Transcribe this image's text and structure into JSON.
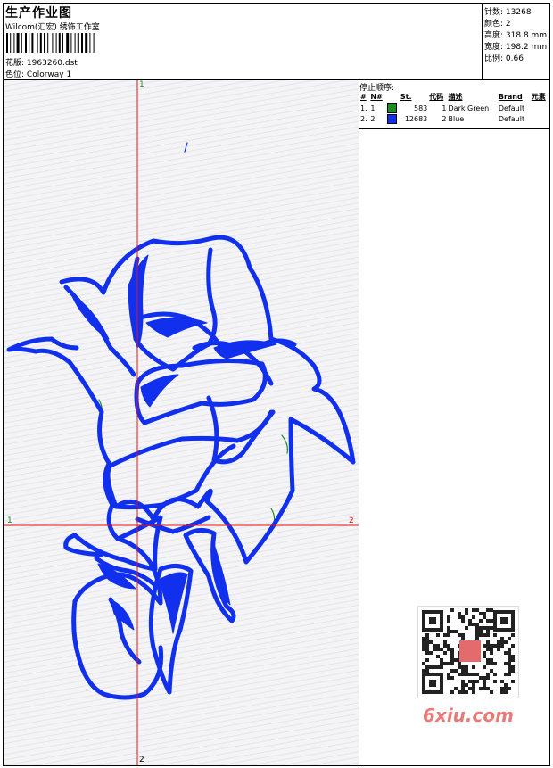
{
  "header": {
    "title": "生产作业图",
    "studio": "Wilcom(汇宏) 绣饰工作室",
    "design_label": "花版:",
    "design_value": "1963260.dst",
    "colorway_label": "色位:",
    "colorway_value": "Colorway 1"
  },
  "stats": {
    "stitches_label": "针数:",
    "stitches_value": "13268",
    "colors_label": "颜色:",
    "colors_value": "2",
    "height_label": "高度:",
    "height_value": "318.8 mm",
    "width_label": "宽度:",
    "width_value": "198.2 mm",
    "scale_label": "比例:",
    "scale_value": "0.66"
  },
  "stop_sequence": {
    "heading": "停止顺序:",
    "columns": [
      "#",
      "N#",
      "St.",
      "代码",
      "描述",
      "Brand",
      "元素"
    ],
    "rows": [
      {
        "idx": "1.",
        "n": "1",
        "color": "#1a8f1a",
        "stitches": "583",
        "code": "1",
        "desc": "Dark Green",
        "brand": "Default"
      },
      {
        "idx": "2.",
        "n": "2",
        "color": "#1030ee",
        "stitches": "12683",
        "code": "2",
        "desc": "Blue",
        "brand": "Default"
      }
    ]
  },
  "axes": {
    "top": "1",
    "bottom": "2",
    "left": "1",
    "right": "2"
  },
  "colors": {
    "thread_blue": "#1030ee",
    "thread_green": "#1a8f1a",
    "crosshair": "#ee1111"
  },
  "watermark": {
    "text": "6xiu.com"
  }
}
